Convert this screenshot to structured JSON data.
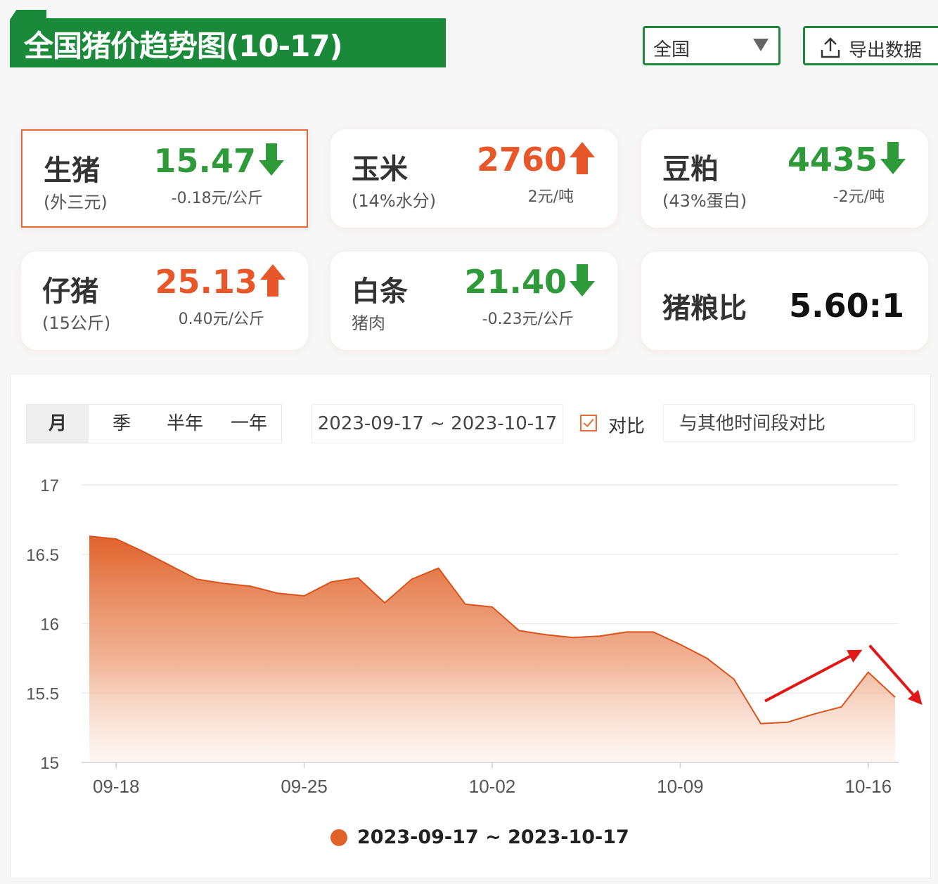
{
  "header": {
    "title": "全国猪价趋势图(10-17)",
    "region_select": "全国",
    "export_label": "导出数据"
  },
  "cards": [
    {
      "name": "生猪",
      "sub": "(外三元)",
      "price": "15.47",
      "direction": "down",
      "change": "-0.18元/公斤"
    },
    {
      "name": "玉米",
      "sub": "(14%水分)",
      "price": "2760",
      "direction": "up",
      "change": "2元/吨"
    },
    {
      "name": "豆粕",
      "sub": "(43%蛋白)",
      "price": "4435",
      "direction": "down",
      "change": "-2元/吨"
    },
    {
      "name": "仔猪",
      "sub": "(15公斤)",
      "price": "25.13",
      "direction": "up",
      "change": "0.40元/公斤"
    },
    {
      "name": "白条",
      "sub": "猪肉",
      "price": "21.40",
      "direction": "down",
      "change": "-0.23元/公斤"
    },
    {
      "name": "猪粮比",
      "ratio": "5.60:1"
    }
  ],
  "controls": {
    "tabs": [
      "月",
      "季",
      "半年",
      "一年"
    ],
    "selected_tab": "月",
    "date_range": "2023-09-17 ~ 2023-10-17",
    "compare_label": "对比",
    "compare_checked": true,
    "compare_placeholder": "与其他时间段对比"
  },
  "colors": {
    "brand_green": "#1a8a3a",
    "up_red": "#e8572a",
    "down_green": "#2f9a3a",
    "series": "#e0622a",
    "annotation_arrow": "#e01818"
  },
  "chart_data": {
    "type": "area",
    "title": "",
    "xlabel": "",
    "ylabel": "",
    "ylim": [
      15,
      17
    ],
    "yticks": [
      "17",
      "16.5",
      "16",
      "15.5",
      "15"
    ],
    "xticks": [
      "09-18",
      "09-25",
      "10-02",
      "10-09",
      "10-16"
    ],
    "grid": true,
    "legend_position": "bottom-center",
    "series": [
      {
        "name": "2023-09-17 ~ 2023-10-17",
        "points": [
          [
            "09-17",
            16.63
          ],
          [
            "09-18",
            16.61
          ],
          [
            "09-19",
            16.52
          ],
          [
            "09-20",
            16.42
          ],
          [
            "09-21",
            16.32
          ],
          [
            "09-22",
            16.29
          ],
          [
            "09-23",
            16.27
          ],
          [
            "09-24",
            16.22
          ],
          [
            "09-25",
            16.2
          ],
          [
            "09-26",
            16.3
          ],
          [
            "09-27",
            16.33
          ],
          [
            "09-28",
            16.15
          ],
          [
            "09-29",
            16.32
          ],
          [
            "09-30",
            16.4
          ],
          [
            "10-01",
            16.14
          ],
          [
            "10-02",
            16.12
          ],
          [
            "10-03",
            15.95
          ],
          [
            "10-04",
            15.92
          ],
          [
            "10-05",
            15.9
          ],
          [
            "10-06",
            15.91
          ],
          [
            "10-07",
            15.94
          ],
          [
            "10-08",
            15.94
          ],
          [
            "10-09",
            15.85
          ],
          [
            "10-10",
            15.75
          ],
          [
            "10-11",
            15.6
          ],
          [
            "10-12",
            15.28
          ],
          [
            "10-13",
            15.29
          ],
          [
            "10-14",
            15.35
          ],
          [
            "10-15",
            15.4
          ],
          [
            "10-16",
            15.65
          ],
          [
            "10-17",
            15.47
          ]
        ]
      }
    ],
    "annotations": [
      "rising arrow over 10-12 to 10-16",
      "falling arrow after 10-16"
    ]
  }
}
